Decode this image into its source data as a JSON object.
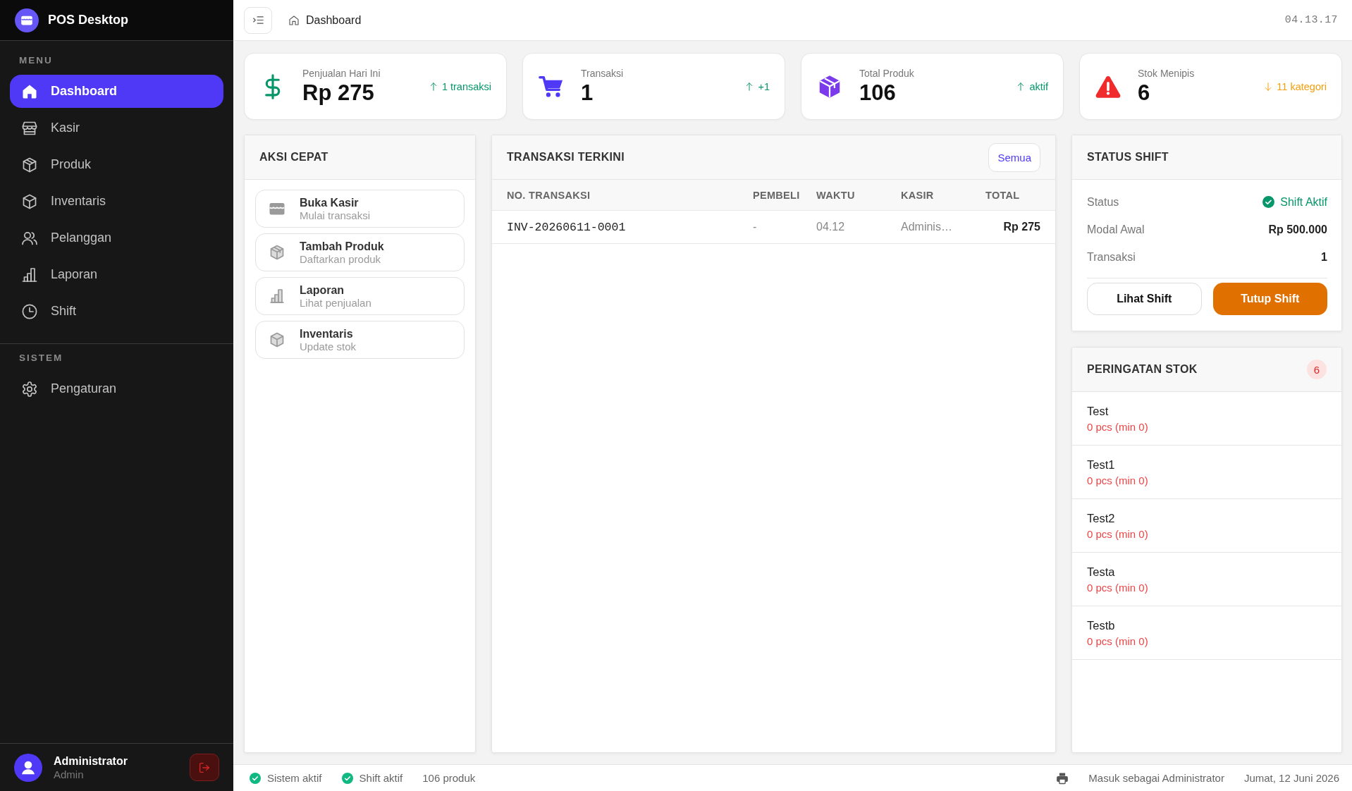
{
  "sidebar": {
    "app_title": "POS Desktop",
    "sections": [
      {
        "label": "MENU",
        "items": [
          {
            "label": "Dashboard",
            "selected": true
          },
          {
            "label": "Kasir",
            "selected": false
          },
          {
            "label": "Produk",
            "selected": false
          },
          {
            "label": "Inventaris",
            "selected": false
          },
          {
            "label": "Pelanggan",
            "selected": false
          },
          {
            "label": "Laporan",
            "selected": false
          },
          {
            "label": "Shift",
            "selected": false
          }
        ]
      },
      {
        "label": "SISTEM",
        "items": [
          {
            "label": "Pengaturan",
            "selected": false
          }
        ]
      }
    ],
    "user": {
      "name": "Administrator",
      "role": "Admin"
    }
  },
  "topbar": {
    "breadcrumb": "Dashboard",
    "clock": "04.13.17"
  },
  "stats": [
    {
      "label": "Penjualan Hari Ini",
      "value": "Rp 275",
      "trend": "1 transaksi",
      "increase": true
    },
    {
      "label": "Transaksi",
      "value": "1",
      "trend": "+1",
      "increase": true
    },
    {
      "label": "Total Produk",
      "value": "106",
      "trend": "aktif",
      "increase": true
    },
    {
      "label": "Stok Menipis",
      "value": "6",
      "trend": "11 kategori",
      "increase": false
    }
  ],
  "quick_actions": {
    "title": "AKSI CEPAT",
    "items": [
      {
        "title": "Buka Kasir",
        "subtitle": "Mulai transaksi"
      },
      {
        "title": "Tambah Produk",
        "subtitle": "Daftarkan produk"
      },
      {
        "title": "Laporan",
        "subtitle": "Lihat penjualan"
      },
      {
        "title": "Inventaris",
        "subtitle": "Update stok"
      }
    ]
  },
  "recent_transactions": {
    "title": "TRANSAKSI TERKINI",
    "view_all": "Semua",
    "columns": [
      "NO. TRANSAKSI",
      "PEMBELI",
      "WAKTU",
      "KASIR",
      "TOTAL"
    ],
    "rows": [
      [
        "INV-20260611-0001",
        "-",
        "04.12",
        "Adminis…",
        "Rp 275"
      ]
    ]
  },
  "shift_status": {
    "title": "STATUS SHIFT",
    "rows": [
      {
        "label": "Status",
        "value": "Shift Aktif",
        "kind": "status"
      },
      {
        "label": "Modal Awal",
        "value": "Rp 500.000",
        "kind": "value"
      },
      {
        "label": "Transaksi",
        "value": "1",
        "kind": "value"
      }
    ],
    "buttons": [
      {
        "label": "Lihat Shift",
        "kind": "secondary"
      },
      {
        "label": "Tutup Shift",
        "kind": "primary"
      }
    ]
  },
  "stock_alerts": {
    "title": "PERINGATAN STOK",
    "count": "6",
    "items": [
      {
        "name": "Test",
        "stock": "0 pcs (min 0)"
      },
      {
        "name": "Test1",
        "stock": "0 pcs (min 0)"
      },
      {
        "name": "Test2",
        "stock": "0 pcs (min 0)"
      },
      {
        "name": "Testa",
        "stock": "0 pcs (min 0)"
      },
      {
        "name": "Testb",
        "stock": "0 pcs (min 0)"
      }
    ]
  },
  "status_bar": {
    "indicators": [
      {
        "label": "Sistem aktif",
        "active": true
      },
      {
        "label": "Shift aktif",
        "active": true
      }
    ],
    "product_count": "106 produk",
    "login_text": "Masuk sebagai Administrator",
    "date": "Jumat, 12 Juni 2026"
  }
}
